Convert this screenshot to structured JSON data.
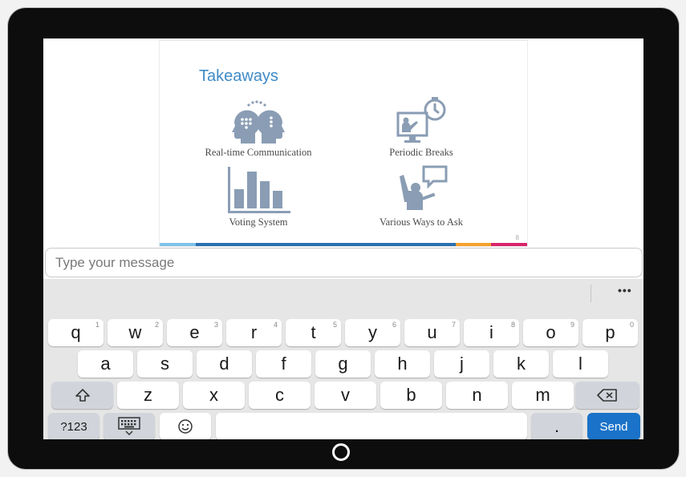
{
  "slide": {
    "title": "Takeaways",
    "items": [
      {
        "label": "Real-time Communication",
        "icon": "heads-communication-icon"
      },
      {
        "label": "Periodic Breaks",
        "icon": "presentation-timer-icon"
      },
      {
        "label": "Voting System",
        "icon": "bar-chart-icon"
      },
      {
        "label": "Various Ways to Ask",
        "icon": "raised-hand-question-icon"
      }
    ],
    "page_number": "8",
    "bar_colors": [
      "#7ec3ea",
      "#2a6fb0",
      "#f4a12b",
      "#d9236b"
    ]
  },
  "message": {
    "placeholder": "Type your message"
  },
  "keyboard": {
    "more_label": "•••",
    "row1": [
      {
        "key": "q",
        "hint": "1"
      },
      {
        "key": "w",
        "hint": "2"
      },
      {
        "key": "e",
        "hint": "3"
      },
      {
        "key": "r",
        "hint": "4"
      },
      {
        "key": "t",
        "hint": "5"
      },
      {
        "key": "y",
        "hint": "6"
      },
      {
        "key": "u",
        "hint": "7"
      },
      {
        "key": "i",
        "hint": "8"
      },
      {
        "key": "o",
        "hint": "9"
      },
      {
        "key": "p",
        "hint": "0"
      }
    ],
    "row2": [
      "a",
      "s",
      "d",
      "f",
      "g",
      "h",
      "j",
      "k",
      "l"
    ],
    "row3": [
      "z",
      "x",
      "c",
      "v",
      "b",
      "n",
      "m"
    ],
    "symbols_label": "?123",
    "period_label": ".",
    "send_label": "Send",
    "shift_icon": "shift-arrow-icon",
    "backspace_icon": "backspace-icon",
    "keyboard_hide_icon": "keyboard-hide-icon",
    "emoji_icon": "emoji-smiley-icon"
  }
}
